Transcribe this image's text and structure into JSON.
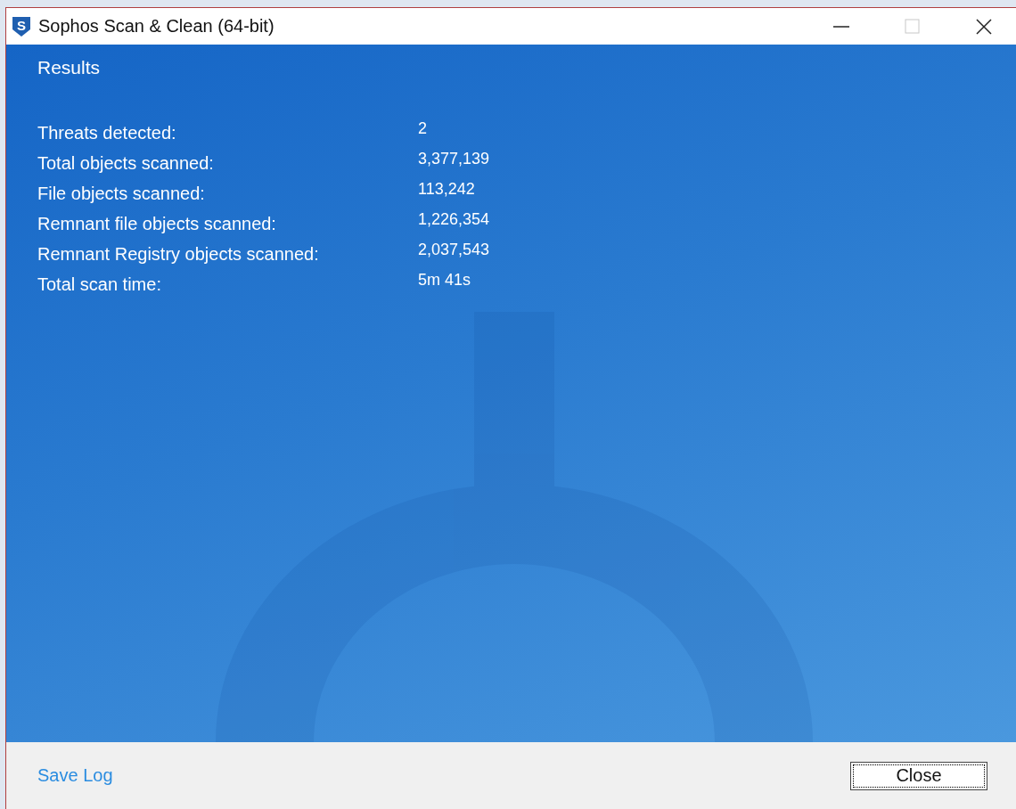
{
  "window": {
    "logo_letter": "S",
    "title": "Sophos Scan & Clean (64-bit)",
    "maximize_disabled": true
  },
  "heading": "Results",
  "stats": [
    {
      "label": "Threats detected:",
      "value": "2"
    },
    {
      "label": "Total objects scanned:",
      "value": "3,377,139"
    },
    {
      "label": "File objects scanned:",
      "value": "113,242"
    },
    {
      "label": "Remnant file objects scanned:",
      "value": "1,226,354"
    },
    {
      "label": "Remnant Registry objects scanned:",
      "value": "2,037,543"
    },
    {
      "label": "Total scan time:",
      "value": "5m 41s"
    }
  ],
  "footer": {
    "link": "Save Log",
    "button": "Close"
  }
}
